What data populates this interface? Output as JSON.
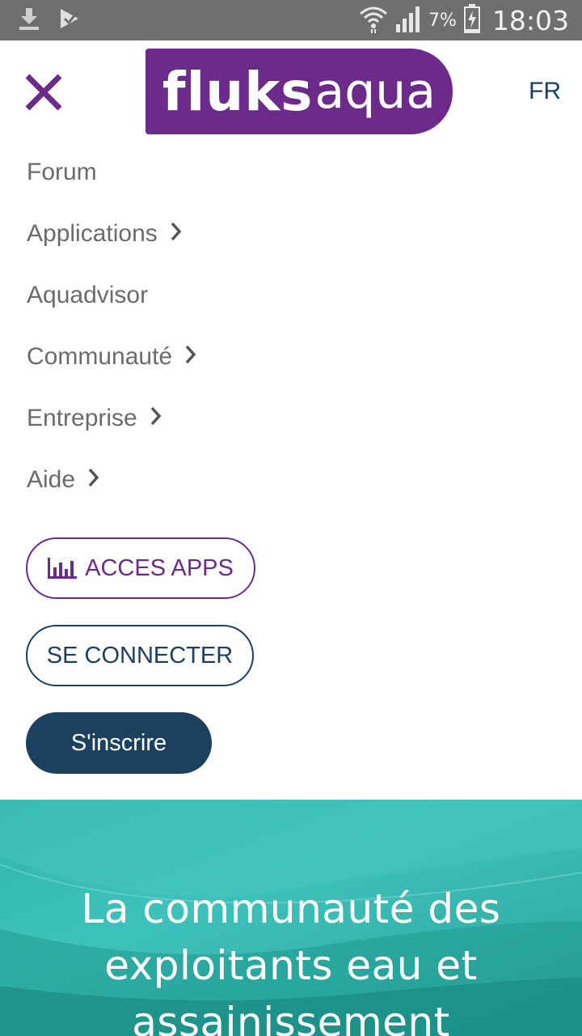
{
  "status_bar": {
    "battery": "7%",
    "time": "18:03",
    "icons": [
      "download-icon",
      "check-notification-icon",
      "wifi-icon",
      "signal-icon",
      "battery-charging-icon"
    ]
  },
  "header": {
    "logo_bold": "fluks",
    "logo_light": "aqua",
    "lang": "FR"
  },
  "menu": {
    "items": [
      {
        "label": "Forum",
        "has_submenu": false
      },
      {
        "label": "Applications",
        "has_submenu": true
      },
      {
        "label": "Aquadvisor",
        "has_submenu": false
      },
      {
        "label": "Communauté",
        "has_submenu": true
      },
      {
        "label": "Entreprise",
        "has_submenu": true
      },
      {
        "label": "Aide",
        "has_submenu": true
      }
    ]
  },
  "buttons": {
    "apps": "ACCES APPS",
    "login": "SE CONNECTER",
    "signup": "S'inscrire"
  },
  "hero": {
    "line1": "La communauté des",
    "line2": "exploitants eau et",
    "line3": "assainissement"
  },
  "colors": {
    "brand_purple": "#6c2a8a",
    "brand_navy": "#1b4060",
    "hero_teal": "#3ec1bb"
  }
}
